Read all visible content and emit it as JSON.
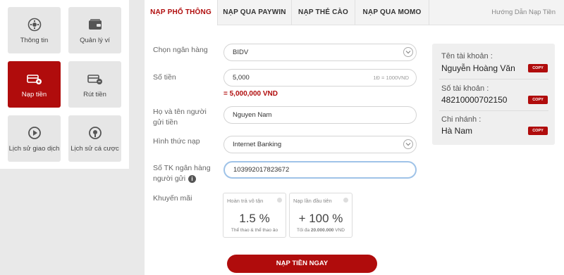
{
  "sidebar": {
    "items": [
      {
        "label": "Thông tin",
        "icon": "gear-icon"
      },
      {
        "label": "Quản lý ví",
        "icon": "wallet-icon"
      },
      {
        "label": "Nạp tiền",
        "icon": "deposit-icon",
        "active": true
      },
      {
        "label": "Rút tiền",
        "icon": "withdraw-icon"
      },
      {
        "label": "Lịch sử giao dịch",
        "icon": "history-icon"
      },
      {
        "label": "Lịch sử cá cược",
        "icon": "bet-history-icon"
      }
    ]
  },
  "tabs": [
    {
      "label": "NẠP PHỔ THÔNG",
      "active": true
    },
    {
      "label": "NẠP QUA PAYWIN"
    },
    {
      "label": "NẠP THẺ CÀO"
    },
    {
      "label": "NẠP QUA MOMO"
    }
  ],
  "guide_link": "Hướng Dẫn Nạp Tiền",
  "form": {
    "bank_label": "Chọn ngân hàng",
    "bank_value": "BIDV",
    "amount_label": "Số tiền",
    "amount_value": "5,000",
    "amount_unit_hint": "1Đ = 1000VND",
    "amount_converted": "= 5,000,000 VND",
    "sender_label_1": "Họ và tên người",
    "sender_label_2": "gửi tiền",
    "sender_value": "Nguyen Nam",
    "method_label": "Hình thức nạp",
    "method_value": "Internet Banking",
    "account_label_1": "Số TK ngân hàng",
    "account_label_2": "người gửi",
    "account_value": "103992017823672",
    "promo_label": "Khuyến mãi",
    "submit_label": "NẠP TIỀN NGAY"
  },
  "promos": [
    {
      "title": "Hoàn trả vô tận",
      "value": "1.5 %",
      "note": "Thể thao & thể thao ảo"
    },
    {
      "title": "Nạp lần đầu tiên",
      "value": "+ 100 %",
      "note_prefix": "Tối đa ",
      "note_bold": "20.000.000",
      "note_suffix": " VND"
    }
  ],
  "account_info": {
    "name_label": "Tên tài khoản :",
    "name_value": "Nguyễn Hoàng Văn",
    "number_label": "Số tài khoản :",
    "number_value": "48210000702150",
    "branch_label": "Chi nhánh :",
    "branch_value": "Hà Nam",
    "copy_label": "COPY"
  },
  "colors": {
    "accent": "#b00c0c",
    "focus": "#9fc3e8"
  }
}
